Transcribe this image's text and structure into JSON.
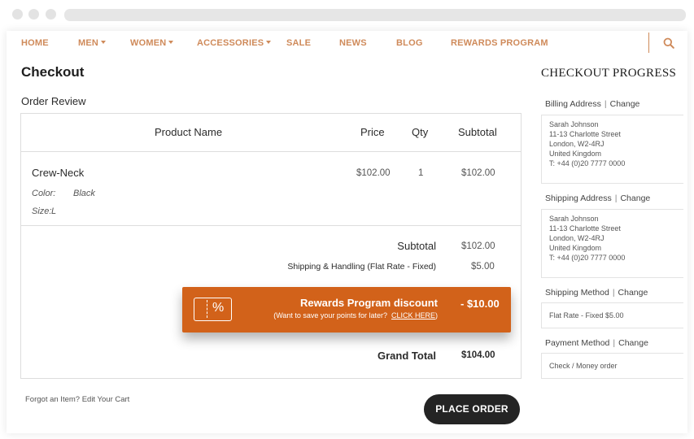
{
  "nav": {
    "items": [
      "HOME",
      "MEN",
      "WOMEN",
      "ACCESSORIES",
      "SALE",
      "NEWS",
      "BLOG",
      "REWARDS PROGRAM"
    ],
    "accent_color": "#cf8a5a"
  },
  "page": {
    "title": "Checkout",
    "section_title": "Order Review"
  },
  "table": {
    "headers": {
      "product": "Product Name",
      "price": "Price",
      "qty": "Qty",
      "subtotal": "Subtotal"
    },
    "rows": [
      {
        "name": "Crew-Neck",
        "price": "$102.00",
        "qty": "1",
        "subtotal": "$102.00",
        "options": [
          {
            "label": "Color:",
            "value": "Black"
          },
          {
            "label": "Size:",
            "value": "L"
          }
        ]
      }
    ]
  },
  "totals": {
    "subtotal_label": "Subtotal",
    "subtotal_value": "$102.00",
    "shipping_label": "Shipping & Handling (Flat Rate - Fixed)",
    "shipping_value": "$5.00",
    "grand_label": "Grand Total",
    "grand_value": "$104.00"
  },
  "rewards": {
    "title": "Rewards Program discount",
    "subtitle": "(Want to save your points for later?",
    "link": "CLICK HERE",
    "subtitle_end": ")",
    "amount": "- $10.00",
    "icon_glyph": "%",
    "color": "#d2621a"
  },
  "footer": {
    "forgot": "Forgot an Item?",
    "edit_cart": "Edit Your Cart",
    "place_order": "PLACE ORDER"
  },
  "sidebar": {
    "title": "CHECKOUT PROGRESS",
    "separator": "|",
    "change_label": "Change",
    "sections": [
      {
        "heading": "Billing Address",
        "lines": [
          "Sarah Johnson",
          "11-13 Charlotte Street",
          "London, W2-4RJ",
          "United Kingdom",
          "T: +44 (0)20 7777 0000"
        ]
      },
      {
        "heading": "Shipping Address",
        "lines": [
          "Sarah Johnson",
          "11-13 Charlotte Street",
          "London, W2-4RJ",
          "United Kingdom",
          "T: +44 (0)20 7777 0000"
        ]
      },
      {
        "heading": "Shipping Method",
        "lines": [
          "Flat Rate - Fixed $5.00"
        ]
      },
      {
        "heading": "Payment Method",
        "lines": [
          "Check / Money order"
        ]
      }
    ]
  }
}
